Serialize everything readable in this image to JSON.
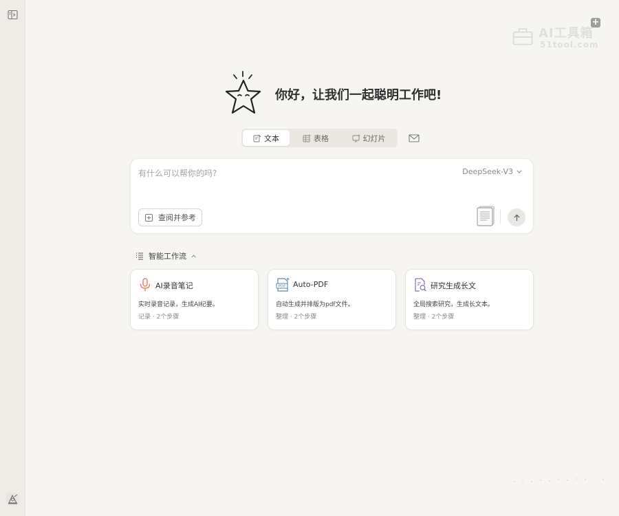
{
  "sidebar": {
    "toggle_icon": "sidebar-toggle-icon",
    "avatar_icon": "user-avatar-icon"
  },
  "watermark": {
    "title": "AI工具箱",
    "subtitle": "51tool.com"
  },
  "hero": {
    "mascot_icon": "star-mascot-icon",
    "greeting": "你好，让我们一起聪明工作吧!"
  },
  "mode_tabs": [
    {
      "label": "文本",
      "icon": "text-edit-icon",
      "active": true
    },
    {
      "label": "表格",
      "icon": "table-icon",
      "active": false
    },
    {
      "label": "幻灯片",
      "icon": "slides-icon",
      "active": false
    }
  ],
  "mail_icon": "mail-icon",
  "chat_input": {
    "placeholder": "有什么可以帮你的吗?",
    "value": "",
    "model": "DeepSeek-V3",
    "reference_button": "查阅并参考",
    "send_icon": "arrow-up-icon"
  },
  "workflows": {
    "header": "智能工作流",
    "items": [
      {
        "title": "AI录音笔记",
        "description": "实时录音记录，生成AI纪要。",
        "meta": "记录 · 2个步骤",
        "icon": "microphone-icon",
        "color": "#e0896a"
      },
      {
        "title": "Auto-PDF",
        "description": "自动生成并排版为pdf文件。",
        "meta": "整理 · 2个步骤",
        "icon": "pdf-icon",
        "color": "#5b87b8"
      },
      {
        "title": "研究生成长文",
        "description": "全局搜索研究，生成长文本。",
        "meta": "整理 · 2个步骤",
        "icon": "document-search-icon",
        "color": "#9272b0"
      }
    ]
  },
  "colors": {
    "background": "#f7f5f1",
    "sidebar": "#efece7",
    "card": "#ffffff"
  }
}
